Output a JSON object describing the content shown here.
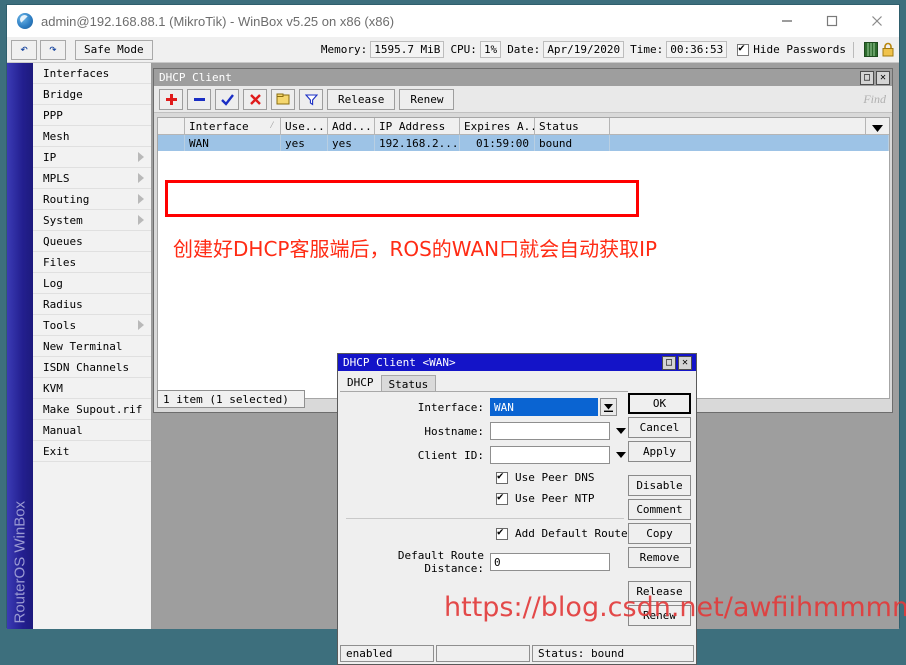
{
  "window": {
    "title": "admin@192.168.88.1 (MikroTik) - WinBox v5.25 on x86 (x86)",
    "icon": "winbox-logo-icon",
    "minimize": "–",
    "maximize": "□",
    "close": "✕"
  },
  "toolbar": {
    "undo_icon": "↶",
    "redo_icon": "↷",
    "safe_mode": "Safe Mode",
    "memory_label": "Memory:",
    "memory_value": "1595.7 MiB",
    "cpu_label": "CPU:",
    "cpu_value": "1%",
    "date_label": "Date:",
    "date_value": "Apr/19/2020",
    "time_label": "Time:",
    "time_value": "00:36:53",
    "hide_passwords": "Hide Passwords"
  },
  "sidebar": {
    "brand": "RouterOS WinBox",
    "items": [
      {
        "label": "Interfaces",
        "submenu": false
      },
      {
        "label": "Bridge",
        "submenu": false
      },
      {
        "label": "PPP",
        "submenu": false
      },
      {
        "label": "Mesh",
        "submenu": false
      },
      {
        "label": "IP",
        "submenu": true
      },
      {
        "label": "MPLS",
        "submenu": true
      },
      {
        "label": "Routing",
        "submenu": true
      },
      {
        "label": "System",
        "submenu": true
      },
      {
        "label": "Queues",
        "submenu": false
      },
      {
        "label": "Files",
        "submenu": false
      },
      {
        "label": "Log",
        "submenu": false
      },
      {
        "label": "Radius",
        "submenu": false
      },
      {
        "label": "Tools",
        "submenu": true
      },
      {
        "label": "New Terminal",
        "submenu": false
      },
      {
        "label": "ISDN Channels",
        "submenu": false
      },
      {
        "label": "KVM",
        "submenu": false
      },
      {
        "label": "Make Supout.rif",
        "submenu": false
      },
      {
        "label": "Manual",
        "submenu": false
      },
      {
        "label": "Exit",
        "submenu": false
      }
    ]
  },
  "dhcp_window": {
    "title": "DHCP Client",
    "restore_label": "□",
    "close_label": "✕",
    "toolbar": {
      "add_icon": "plus-icon",
      "remove_icon": "minus-icon",
      "enable_icon": "check-icon",
      "disable_icon": "cross-icon",
      "comment_icon": "comment-folder-icon",
      "filter_icon": "filter-funnel-icon",
      "release": "Release",
      "renew": "Renew",
      "find": "Find"
    },
    "columns": [
      "",
      "Interface",
      "Use...",
      "Add...",
      "IP Address",
      "Expires A...",
      "Status",
      ""
    ],
    "sort_mark": "⁄",
    "rows": [
      {
        "marker": "",
        "interface": "WAN",
        "use_peer_dns": "yes",
        "add_default_route": "yes",
        "ip_address": "192.168.2...",
        "expires_after": "01:59:00",
        "status": "bound",
        "extra": ""
      }
    ],
    "status_bar": "1 item (1 selected)",
    "scroll_icon": "chevron-down-icon",
    "annotation": "创建好DHCP客服端后，ROS的WAN口就会自动获取IP"
  },
  "dialog": {
    "title": "DHCP Client <WAN>",
    "restore_label": "□",
    "close_label": "✕",
    "tabs": [
      {
        "label": "DHCP",
        "active": true
      },
      {
        "label": "Status",
        "active": false
      }
    ],
    "fields": {
      "interface_label": "Interface:",
      "interface_value": "WAN",
      "hostname_label": "Hostname:",
      "hostname_value": "",
      "client_id_label": "Client ID:",
      "client_id_value": "",
      "default_route_distance_label": "Default Route Distance:",
      "default_route_distance_value": "0"
    },
    "checkboxes": [
      {
        "label": "Use Peer DNS",
        "checked": true
      },
      {
        "label": "Use Peer NTP",
        "checked": true
      },
      {
        "label": "Add Default Route",
        "checked": true
      }
    ],
    "buttons": [
      {
        "label": "OK",
        "primary": true
      },
      {
        "label": "Cancel",
        "primary": false
      },
      {
        "label": "Apply",
        "primary": false
      },
      {
        "label": "Disable",
        "primary": false
      },
      {
        "label": "Comment",
        "primary": false
      },
      {
        "label": "Copy",
        "primary": false
      },
      {
        "label": "Remove",
        "primary": false
      },
      {
        "label": "Release",
        "primary": false
      },
      {
        "label": "Renew",
        "primary": false
      }
    ],
    "status": {
      "enabled": "enabled",
      "middle": "",
      "state": "Status: bound"
    }
  },
  "watermark": "https://blog.csdn.net/awfiihmmmm",
  "colors": {
    "desktop": "#9e9e9e",
    "sidebar": "#231f8f",
    "dialog_title": "#1414c8",
    "selection": "#9dc3e6",
    "annotation": "#ff2b14",
    "accent_input": "#0a64d2"
  }
}
